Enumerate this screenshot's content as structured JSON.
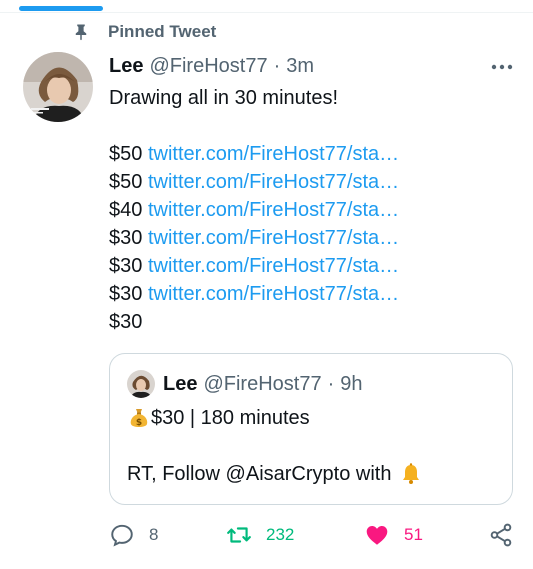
{
  "pinned_label": "Pinned Tweet",
  "tweet": {
    "name": "Lee",
    "handle": "@FireHost77",
    "separator": "·",
    "time": "3m",
    "text_first": "Drawing all in 30 minutes!",
    "lines": [
      {
        "price": "$50",
        "link": "twitter.com/FireHost77/sta…"
      },
      {
        "price": "$50",
        "link": "twitter.com/FireHost77/sta…"
      },
      {
        "price": "$40",
        "link": "twitter.com/FireHost77/sta…"
      },
      {
        "price": "$30",
        "link": "twitter.com/FireHost77/sta…"
      },
      {
        "price": "$30",
        "link": "twitter.com/FireHost77/sta…"
      },
      {
        "price": "$30",
        "link": "twitter.com/FireHost77/sta…"
      }
    ],
    "last_price": "$30"
  },
  "quote": {
    "name": "Lee",
    "handle": "@FireHost77",
    "separator": "·",
    "time": "9h",
    "line1": "$30 | 180 minutes",
    "line2": "RT, Follow @AisarCrypto with",
    "icons": [
      "money-bag-icon",
      "bell-icon"
    ]
  },
  "actions": {
    "replies": "8",
    "retweets": "232",
    "likes": "51"
  },
  "colors": {
    "accent": "#1d9bf0",
    "retweet": "#00ba7c",
    "like": "#f91880",
    "muted": "#536471"
  }
}
